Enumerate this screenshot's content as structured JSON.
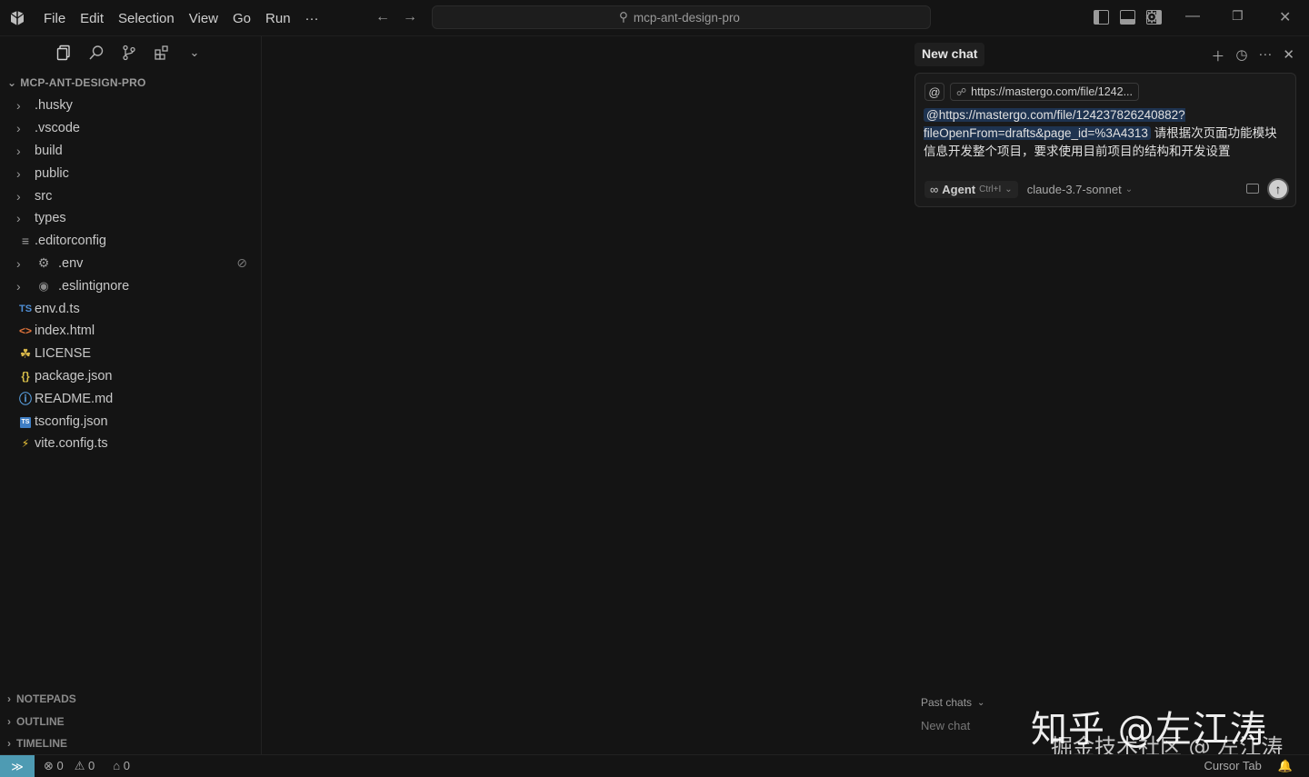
{
  "menu": [
    "File",
    "Edit",
    "Selection",
    "View",
    "Go",
    "Run",
    "···"
  ],
  "search": {
    "text": "mcp-ant-design-pro"
  },
  "explorer": {
    "title": "MCP-ANT-DESIGN-PRO",
    "items": [
      {
        "label": ".husky",
        "type": "folder"
      },
      {
        "label": ".vscode",
        "type": "folder"
      },
      {
        "label": "build",
        "type": "folder"
      },
      {
        "label": "public",
        "type": "folder"
      },
      {
        "label": "src",
        "type": "folder"
      },
      {
        "label": "types",
        "type": "folder"
      },
      {
        "label": ".editorconfig",
        "type": "file",
        "icon": "≡"
      },
      {
        "label": ".env",
        "type": "folder-file",
        "icon": "⚙"
      },
      {
        "label": ".eslintignore",
        "type": "folder-file",
        "icon": "◉"
      },
      {
        "label": "env.d.ts",
        "type": "file",
        "icon": "TS"
      },
      {
        "label": "index.html",
        "type": "file",
        "icon": "<>"
      },
      {
        "label": "LICENSE",
        "type": "file",
        "icon": "⚓"
      },
      {
        "label": "package.json",
        "type": "file",
        "icon": "{}"
      },
      {
        "label": "README.md",
        "type": "file",
        "icon": "ⓘ"
      },
      {
        "label": "tsconfig.json",
        "type": "file",
        "icon": "TS"
      },
      {
        "label": "vite.config.ts",
        "type": "file",
        "icon": "⚡"
      }
    ],
    "sections": [
      "NOTEPADS",
      "OUTLINE",
      "TIMELINE"
    ]
  },
  "chat": {
    "tab_label": "New chat",
    "context_chip": "https://mastergo.com/file/1242...",
    "message_link": "@https://mastergo.com/file/124237826240882?fileOpenFrom=drafts&page_id=%3A4313",
    "message_link_line1": "@https://mastergo.com/file/124237826240882?",
    "message_link_line2": "fileOpenFrom=drafts&page_id=%3A4313",
    "message_text": "请根据次页面功能模块信息开发整个项目，要求使用目前项目的结构和开发设置",
    "agent_label": "Agent",
    "agent_shortcut": "Ctrl+I",
    "model": "claude-3.7-sonnet",
    "past_chats_label": "Past chats",
    "past_chat_item": "New chat"
  },
  "watermark": {
    "line1": "知乎 @左江涛",
    "line2": "掘金技术社区 @ 左江涛"
  },
  "status": {
    "errors": "0",
    "warnings": "0",
    "ports": "0",
    "cursor_tab": "Cursor Tab"
  },
  "colors": {
    "background": "#141414",
    "remote_indicator": "#4e9bb3",
    "link_highlight": "#1e3350"
  }
}
